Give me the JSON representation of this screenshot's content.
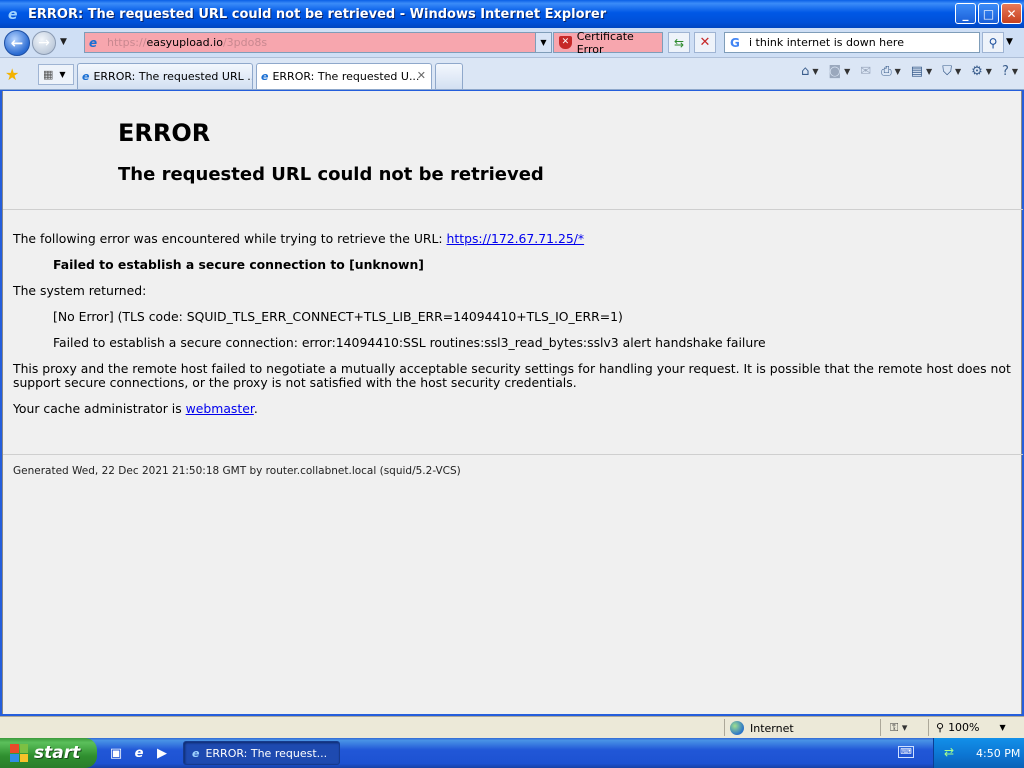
{
  "window": {
    "title": "ERROR: The requested URL could not be retrieved - Windows Internet Explorer",
    "minimize": "_",
    "maximize": "□",
    "close": "✕"
  },
  "navbar": {
    "url_prefix": "https://",
    "url_host": "easyupload.io",
    "url_suffix": "/3pdo8s",
    "cert_error": "Certificate Error",
    "search_text": "i think internet is down here"
  },
  "tabs": [
    {
      "label": "ERROR: The requested URL ..."
    },
    {
      "label": "ERROR: The requested U..."
    }
  ],
  "page": {
    "heading": "ERROR",
    "subheading": "The requested URL could not be retrieved",
    "intro": "The following error was encountered while trying to retrieve the URL:",
    "url_link": "https://172.67.71.25/*",
    "failed_msg": "Failed to establish a secure connection to [unknown]",
    "system_returned": "The system returned:",
    "tls_code": "[No Error] (TLS code: SQUID_TLS_ERR_CONNECT+TLS_LIB_ERR=14094410+TLS_IO_ERR=1)",
    "ssl_error": "Failed to establish a secure connection: error:14094410:SSL routines:ssl3_read_bytes:sslv3 alert handshake failure",
    "explanation": "This proxy and the remote host failed to negotiate a mutually acceptable security settings for handling your request. It is possible that the remote host does not support secure connections, or the proxy is not satisfied with the host security credentials.",
    "admin_prefix": "Your cache administrator is",
    "admin_link": "webmaster",
    "admin_suffix": ".",
    "footer": "Generated Wed, 22 Dec 2021 21:50:18 GMT by router.collabnet.local (squid/5.2-VCS)"
  },
  "statusbar": {
    "zone": "Internet",
    "zoom": "100%"
  },
  "taskbar": {
    "start": "start",
    "task_item": "ERROR: The request...",
    "clock": "4:50 PM"
  }
}
